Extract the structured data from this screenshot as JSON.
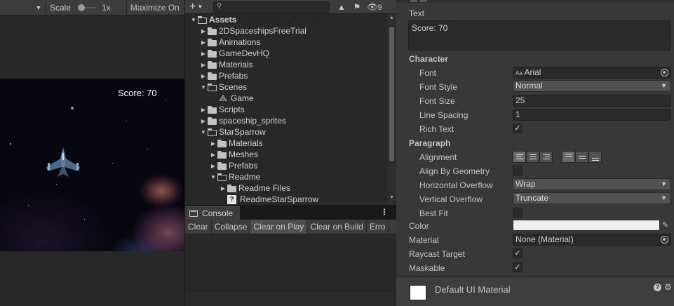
{
  "game_view": {
    "toolbar": {
      "scale_label": "Scale",
      "scale_value": "1x",
      "maximize_label": "Maximize On"
    },
    "score_text": "Score: 70"
  },
  "project": {
    "toolbar": {
      "add_label": "+",
      "search_placeholder": "",
      "hidden_count": "9"
    },
    "tree": [
      {
        "label": "Assets",
        "depth": 0,
        "expanded": true,
        "kind": "folder",
        "bold": true
      },
      {
        "label": "2DSpaceshipsFreeTrial",
        "depth": 1,
        "expanded": false,
        "kind": "folder"
      },
      {
        "label": "Animations",
        "depth": 1,
        "expanded": false,
        "kind": "folder"
      },
      {
        "label": "GameDevHQ",
        "depth": 1,
        "expanded": false,
        "kind": "folder"
      },
      {
        "label": "Materials",
        "depth": 1,
        "expanded": false,
        "kind": "folder"
      },
      {
        "label": "Prefabs",
        "depth": 1,
        "expanded": false,
        "kind": "folder"
      },
      {
        "label": "Scenes",
        "depth": 1,
        "expanded": true,
        "kind": "folder"
      },
      {
        "label": "Game",
        "depth": 2,
        "kind": "scene"
      },
      {
        "label": "Scripts",
        "depth": 1,
        "expanded": false,
        "kind": "folder"
      },
      {
        "label": "spaceship_sprites",
        "depth": 1,
        "expanded": false,
        "kind": "folder"
      },
      {
        "label": "StarSparrow",
        "depth": 1,
        "expanded": true,
        "kind": "folder"
      },
      {
        "label": "Materials",
        "depth": 2,
        "expanded": false,
        "kind": "folder"
      },
      {
        "label": "Meshes",
        "depth": 2,
        "expanded": false,
        "kind": "folder"
      },
      {
        "label": "Prefabs",
        "depth": 2,
        "expanded": false,
        "kind": "folder"
      },
      {
        "label": "Readme",
        "depth": 2,
        "expanded": true,
        "kind": "folder"
      },
      {
        "label": "Readme Files",
        "depth": 3,
        "expanded": false,
        "kind": "folder"
      },
      {
        "label": "ReadmeStarSparrow",
        "depth": 3,
        "kind": "unknown"
      }
    ]
  },
  "console": {
    "tab_label": "Console",
    "menu_glyph": "⋮",
    "toolbar": {
      "clear": "Clear",
      "collapse": "Collapse",
      "clear_on_play": "Clear on Play",
      "clear_on_build": "Clear on Build",
      "error_pause": "Erro"
    }
  },
  "inspector": {
    "text_label": "Text",
    "text_value": "Score: 70",
    "character_header": "Character",
    "font_label": "Font",
    "font_value": "Arial",
    "font_style_label": "Font Style",
    "font_style_value": "Normal",
    "font_size_label": "Font Size",
    "font_size_value": "25",
    "line_spacing_label": "Line Spacing",
    "line_spacing_value": "1",
    "rich_text_label": "Rich Text",
    "rich_text_checked": true,
    "paragraph_header": "Paragraph",
    "alignment_label": "Alignment",
    "align_by_geometry_label": "Align By Geometry",
    "align_by_geometry_checked": false,
    "horizontal_overflow_label": "Horizontal Overflow",
    "horizontal_overflow_value": "Wrap",
    "vertical_overflow_label": "Vertical Overflow",
    "vertical_overflow_value": "Truncate",
    "best_fit_label": "Best Fit",
    "best_fit_checked": false,
    "color_label": "Color",
    "color_value": "#f1eeee",
    "material_label": "Material",
    "material_value": "None (Material)",
    "raycast_target_label": "Raycast Target",
    "raycast_target_checked": true,
    "maskable_label": "Maskable",
    "maskable_checked": true,
    "check_glyph": "✓",
    "material_section": {
      "name": "Default UI Material"
    }
  }
}
